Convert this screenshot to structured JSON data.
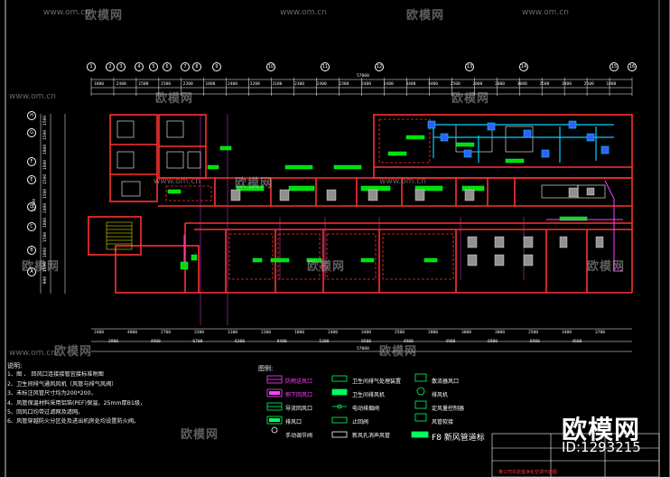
{
  "watermarks": {
    "url": "www.om.cn",
    "site": "欧模网"
  },
  "drawing": {
    "axis_numbers": [
      "1",
      "2",
      "3",
      "4",
      "5",
      "6",
      "7",
      "8",
      "9",
      "10",
      "11",
      "12",
      "13",
      "14",
      "15",
      "16"
    ],
    "axis_letters": [
      "H",
      "G",
      "F",
      "E",
      "D",
      "C",
      "B",
      "A"
    ],
    "top_dimensions": [
      "1800",
      "2400",
      "1500",
      "1500",
      "2300",
      "1800",
      "2400",
      "3200",
      "3100",
      "2300",
      "2400",
      "2300",
      "2400",
      "2400",
      "3400",
      "3400",
      "2500",
      "2000",
      "2000",
      "3000",
      "2500",
      "3400",
      "2500",
      "1800"
    ],
    "top_total": "57000",
    "bottom_dimensions": [
      "2400",
      "4000",
      "2700",
      "3300",
      "3100",
      "2300",
      "1800",
      "2400",
      "3400",
      "2500",
      "2000",
      "3000",
      "3000",
      "2500",
      "3400",
      "3700"
    ],
    "bottom_mid": [
      "3900",
      "4900",
      "6700",
      "6300",
      "9400",
      "5300",
      "8500",
      "4900",
      "4900",
      "6900",
      "6900",
      "4600"
    ],
    "bottom_total": "57000",
    "left_dimensions": [
      "1500",
      "1500",
      "1800",
      "1800",
      "1500",
      "1500",
      "2400",
      "1800",
      "1500",
      "1800",
      "1500",
      "900"
    ],
    "left_total": "22700"
  },
  "notes": {
    "title": "说明:",
    "lines": [
      "1、图 、 回风口连接接管宜接标准附图",
      "2、卫生间排气通风风机（风管与排气风阀）",
      "3、未标注风管尺寸均为200*200，",
      "4、风管保温材料采用铝箔(PEF)保温，25mm厚B1级，",
      "5、回风口均带过滤网及滤网。",
      "6、风管穿越防火分区处及进出机房处均设置防火阀。"
    ]
  },
  "legend": {
    "title": "图例:",
    "items": [
      {
        "label": "防雨送风口",
        "color": "#ff40ff"
      },
      {
        "label": "卫生间排气处理装置",
        "color": "#ffffff"
      },
      {
        "label": "散流器风口",
        "color": "#ffffff"
      },
      {
        "label": "侧下回风口",
        "color": "#ff40ff"
      },
      {
        "label": "卫生间排风机",
        "color": "#ffffff"
      },
      {
        "label": "排风机",
        "color": "#ffffff"
      },
      {
        "label": "导流回风口",
        "color": "#ffffff"
      },
      {
        "label": "电动排烟阀",
        "color": "#ffffff"
      },
      {
        "label": "定风量控制器",
        "color": "#ffffff"
      },
      {
        "label": "排风口",
        "color": "#ffffff"
      },
      {
        "label": "止回阀",
        "color": "#ffffff"
      },
      {
        "label": "风管软接",
        "color": "#ffffff"
      },
      {
        "label": "手动调节阀",
        "color": "#ffffff"
      },
      {
        "label": "新风孔消声风管",
        "color": "#ffffff"
      },
      {
        "label": "F8 新风管道标",
        "color": "#ffffff"
      }
    ]
  },
  "brand": {
    "name": "欧模网",
    "id": "ID:1293215"
  },
  "title_block": {
    "text": "某公司实验室净化空调平面图"
  }
}
